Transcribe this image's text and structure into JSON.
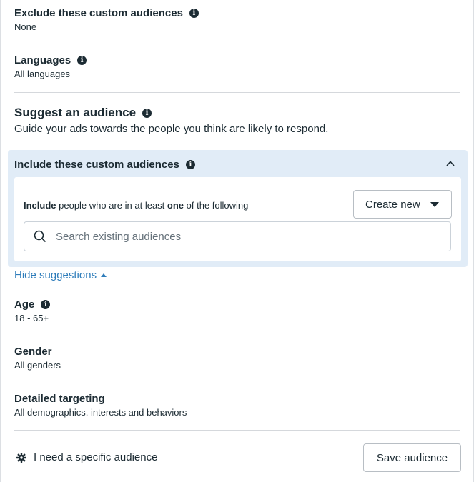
{
  "exclude": {
    "label": "Exclude these custom audiences",
    "value": "None"
  },
  "languages": {
    "label": "Languages",
    "value": "All languages"
  },
  "suggest": {
    "title": "Suggest an audience",
    "description": "Guide your ads towards the people you think are likely to respond."
  },
  "custom": {
    "title": "Include these custom audiences",
    "include_bold1": "Include",
    "include_mid": " people who are in at least ",
    "include_bold2": "one",
    "include_end": " of the following",
    "create_label": "Create new",
    "search_placeholder": "Search existing audiences"
  },
  "hide_suggestions": "Hide suggestions",
  "age": {
    "label": "Age",
    "value": "18 - 65+"
  },
  "gender": {
    "label": "Gender",
    "value": "All genders"
  },
  "detailed": {
    "label": "Detailed targeting",
    "value": "All demographics, interests and behaviors"
  },
  "footer": {
    "specific_label": "I need a specific audience",
    "save_label": "Save audience"
  },
  "icons": {
    "info": "info-icon",
    "chevron": "chevron-up-icon",
    "search": "search-icon",
    "gear": "gear-icon"
  }
}
